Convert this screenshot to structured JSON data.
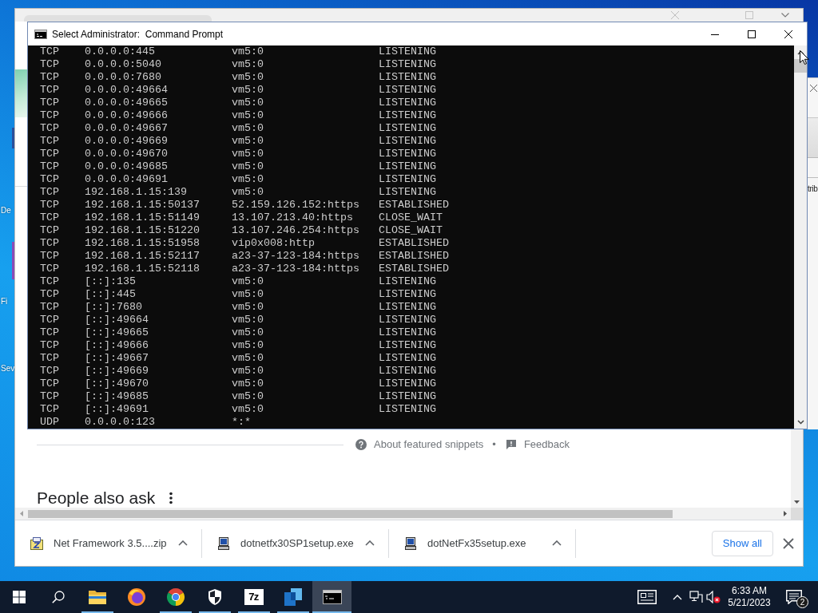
{
  "desktop": {
    "icon_labels": [
      "De",
      "Fi",
      "Sev"
    ]
  },
  "side_window": {
    "text": "trib"
  },
  "browser": {
    "page": {
      "links": [
        {
          "kind": "help",
          "label": "About featured snippets"
        },
        {
          "kind": "feedback",
          "label": "Feedback"
        }
      ],
      "link_separator": "•",
      "heading": "People also ask"
    },
    "downloads": [
      {
        "kind": "zip",
        "filename": "Net Framework 3.5....zip"
      },
      {
        "kind": "exe",
        "filename": "dotnetfx30SP1setup.exe"
      },
      {
        "kind": "exe",
        "filename": "dotNetFx35setup.exe"
      }
    ],
    "show_all_button": "Show all"
  },
  "console_window": {
    "title": "Select Administrator:  Command Prompt",
    "rows": [
      {
        "protocol": "TCP",
        "local_address": "0.0.0.0:445",
        "foreign_address": "vm5:0",
        "state": "LISTENING"
      },
      {
        "protocol": "TCP",
        "local_address": "0.0.0.0:5040",
        "foreign_address": "vm5:0",
        "state": "LISTENING"
      },
      {
        "protocol": "TCP",
        "local_address": "0.0.0.0:7680",
        "foreign_address": "vm5:0",
        "state": "LISTENING"
      },
      {
        "protocol": "TCP",
        "local_address": "0.0.0.0:49664",
        "foreign_address": "vm5:0",
        "state": "LISTENING"
      },
      {
        "protocol": "TCP",
        "local_address": "0.0.0.0:49665",
        "foreign_address": "vm5:0",
        "state": "LISTENING"
      },
      {
        "protocol": "TCP",
        "local_address": "0.0.0.0:49666",
        "foreign_address": "vm5:0",
        "state": "LISTENING"
      },
      {
        "protocol": "TCP",
        "local_address": "0.0.0.0:49667",
        "foreign_address": "vm5:0",
        "state": "LISTENING"
      },
      {
        "protocol": "TCP",
        "local_address": "0.0.0.0:49669",
        "foreign_address": "vm5:0",
        "state": "LISTENING"
      },
      {
        "protocol": "TCP",
        "local_address": "0.0.0.0:49670",
        "foreign_address": "vm5:0",
        "state": "LISTENING"
      },
      {
        "protocol": "TCP",
        "local_address": "0.0.0.0:49685",
        "foreign_address": "vm5:0",
        "state": "LISTENING"
      },
      {
        "protocol": "TCP",
        "local_address": "0.0.0.0:49691",
        "foreign_address": "vm5:0",
        "state": "LISTENING"
      },
      {
        "protocol": "TCP",
        "local_address": "192.168.1.15:139",
        "foreign_address": "vm5:0",
        "state": "LISTENING"
      },
      {
        "protocol": "TCP",
        "local_address": "192.168.1.15:50137",
        "foreign_address": "52.159.126.152:https",
        "state": "ESTABLISHED"
      },
      {
        "protocol": "TCP",
        "local_address": "192.168.1.15:51149",
        "foreign_address": "13.107.213.40:https",
        "state": "CLOSE_WAIT"
      },
      {
        "protocol": "TCP",
        "local_address": "192.168.1.15:51220",
        "foreign_address": "13.107.246.254:https",
        "state": "CLOSE_WAIT"
      },
      {
        "protocol": "TCP",
        "local_address": "192.168.1.15:51958",
        "foreign_address": "vip0x008:http",
        "state": "ESTABLISHED"
      },
      {
        "protocol": "TCP",
        "local_address": "192.168.1.15:52117",
        "foreign_address": "a23-37-123-184:https",
        "state": "ESTABLISHED"
      },
      {
        "protocol": "TCP",
        "local_address": "192.168.1.15:52118",
        "foreign_address": "a23-37-123-184:https",
        "state": "ESTABLISHED"
      },
      {
        "protocol": "TCP",
        "local_address": "[::]:135",
        "foreign_address": "vm5:0",
        "state": "LISTENING"
      },
      {
        "protocol": "TCP",
        "local_address": "[::]:445",
        "foreign_address": "vm5:0",
        "state": "LISTENING"
      },
      {
        "protocol": "TCP",
        "local_address": "[::]:7680",
        "foreign_address": "vm5:0",
        "state": "LISTENING"
      },
      {
        "protocol": "TCP",
        "local_address": "[::]:49664",
        "foreign_address": "vm5:0",
        "state": "LISTENING"
      },
      {
        "protocol": "TCP",
        "local_address": "[::]:49665",
        "foreign_address": "vm5:0",
        "state": "LISTENING"
      },
      {
        "protocol": "TCP",
        "local_address": "[::]:49666",
        "foreign_address": "vm5:0",
        "state": "LISTENING"
      },
      {
        "protocol": "TCP",
        "local_address": "[::]:49667",
        "foreign_address": "vm5:0",
        "state": "LISTENING"
      },
      {
        "protocol": "TCP",
        "local_address": "[::]:49669",
        "foreign_address": "vm5:0",
        "state": "LISTENING"
      },
      {
        "protocol": "TCP",
        "local_address": "[::]:49670",
        "foreign_address": "vm5:0",
        "state": "LISTENING"
      },
      {
        "protocol": "TCP",
        "local_address": "[::]:49685",
        "foreign_address": "vm5:0",
        "state": "LISTENING"
      },
      {
        "protocol": "TCP",
        "local_address": "[::]:49691",
        "foreign_address": "vm5:0",
        "state": "LISTENING"
      },
      {
        "protocol": "UDP",
        "local_address": "0.0.0.0:123",
        "foreign_address": "*:*"
      }
    ]
  },
  "taskbar": {
    "apps": [
      {
        "kind": "explorer",
        "running": true,
        "selected": false
      },
      {
        "kind": "firefox",
        "running": false,
        "selected": false
      },
      {
        "kind": "chrome",
        "running": true,
        "selected": false
      },
      {
        "kind": "security",
        "running": true,
        "selected": false
      },
      {
        "kind": "archiver",
        "icon_text": "7z",
        "running": true,
        "selected": false
      },
      {
        "kind": "window",
        "running": true,
        "selected": false
      },
      {
        "kind": "console",
        "running": true,
        "selected": true
      }
    ],
    "clock": {
      "time": "6:33 AM",
      "date": "5/21/2023"
    },
    "notification_count": "2"
  }
}
